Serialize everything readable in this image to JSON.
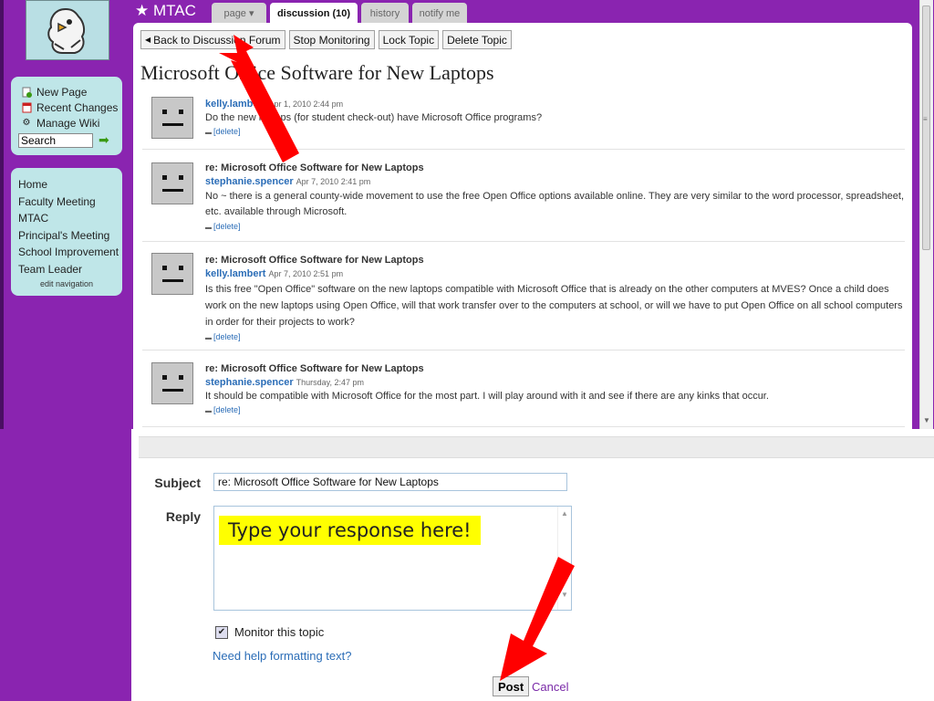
{
  "wiki": {
    "title": "MTAC"
  },
  "tabs": [
    {
      "label": "page",
      "active": false
    },
    {
      "label": "discussion (10)",
      "active": true
    },
    {
      "label": "history",
      "active": false
    },
    {
      "label": "notify me",
      "active": false
    }
  ],
  "sidebar": {
    "tools": [
      {
        "label": "New Page",
        "icon": "new-page-icon"
      },
      {
        "label": "Recent Changes",
        "icon": "calendar-icon"
      },
      {
        "label": "Manage Wiki",
        "icon": "gear-icon"
      }
    ],
    "search_value": "Search",
    "nav": [
      "Home",
      "Faculty Meeting",
      "MTAC",
      "Principal's Meeting",
      "School Improvement",
      "Team Leader"
    ],
    "edit_nav": "edit navigation"
  },
  "toolbar": {
    "back": "Back to Discussion Forum",
    "stop": "Stop Monitoring",
    "lock": "Lock Topic",
    "delete": "Delete Topic"
  },
  "topic": {
    "title": "Microsoft Office Software for New Laptops"
  },
  "posts": [
    {
      "subject": "",
      "author": "kelly.lambert",
      "time": "Apr 1, 2010 2:44 pm",
      "text": "Do the new laptops (for student check-out) have Microsoft Office programs?",
      "delete": "[delete]"
    },
    {
      "subject": "re: Microsoft Office Software for New Laptops",
      "author": "stephanie.spencer",
      "time": "Apr 7, 2010 2:41 pm",
      "text": "No ~ there is a general county-wide movement to use the free Open Office options available online. They are very similar to the word processor, spreadsheet, etc. available through Microsoft.",
      "delete": "[delete]"
    },
    {
      "subject": "re: Microsoft Office Software for New Laptops",
      "author": "kelly.lambert",
      "time": "Apr 7, 2010 2:51 pm",
      "text": "Is this free \"Open Office\" software on the new laptops compatible with Microsoft Office that is already on the other computers at MVES? Once a child does work on the new laptops using Open Office, will that work transfer over to the computers at school, or will we have to put Open Office on all school computers in order for their projects to work?",
      "delete": "[delete]"
    },
    {
      "subject": "re: Microsoft Office Software for New Laptops",
      "author": "stephanie.spencer",
      "time": "Thursday, 2:47 pm",
      "text": "It should be compatible with Microsoft Office for the most part. I will play around with it and see if there are any kinks that occur.",
      "delete": "[delete]"
    }
  ],
  "reply": {
    "subject_label": "Subject",
    "subject_value": "re: Microsoft Office Software for New Laptops",
    "reply_label": "Reply",
    "hint": "Type your response here!",
    "monitor_label": "Monitor this topic",
    "monitor_checked": true,
    "help_link": "Need help formatting text?",
    "post_button": "Post",
    "cancel": "Cancel"
  },
  "colors": {
    "purple": "#8a24b0",
    "sidebar": "#bfe6e8",
    "link": "#2b6db7",
    "highlight": "#ffff00",
    "arrow": "#ff0000"
  }
}
